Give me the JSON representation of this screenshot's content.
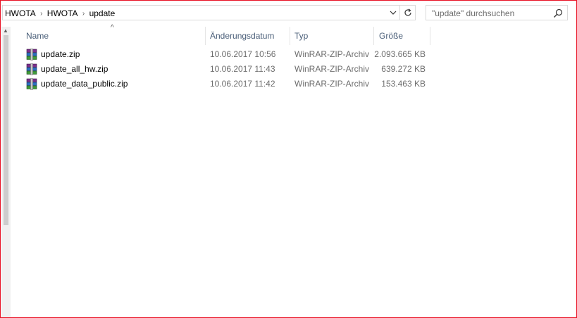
{
  "breadcrumb": [
    "HWOTA",
    "HWOTA",
    "update"
  ],
  "search": {
    "placeholder": "\"update\" durchsuchen"
  },
  "columns": {
    "name": "Name",
    "date": "Änderungsdatum",
    "type": "Typ",
    "size": "Größe"
  },
  "files": [
    {
      "name": "update.zip",
      "date": "10.06.2017 10:56",
      "type": "WinRAR-ZIP-Archiv",
      "size": "2.093.665 KB",
      "icon": "winrar-archive-icon"
    },
    {
      "name": "update_all_hw.zip",
      "date": "10.06.2017 11:43",
      "type": "WinRAR-ZIP-Archiv",
      "size": "639.272 KB",
      "icon": "winrar-archive-icon"
    },
    {
      "name": "update_data_public.zip",
      "date": "10.06.2017 11:42",
      "type": "WinRAR-ZIP-Archiv",
      "size": "153.463 KB",
      "icon": "winrar-archive-icon"
    }
  ],
  "colors": {
    "border": "#e81123",
    "header_text": "#4c607a",
    "meta_text": "#6d6d6d"
  }
}
